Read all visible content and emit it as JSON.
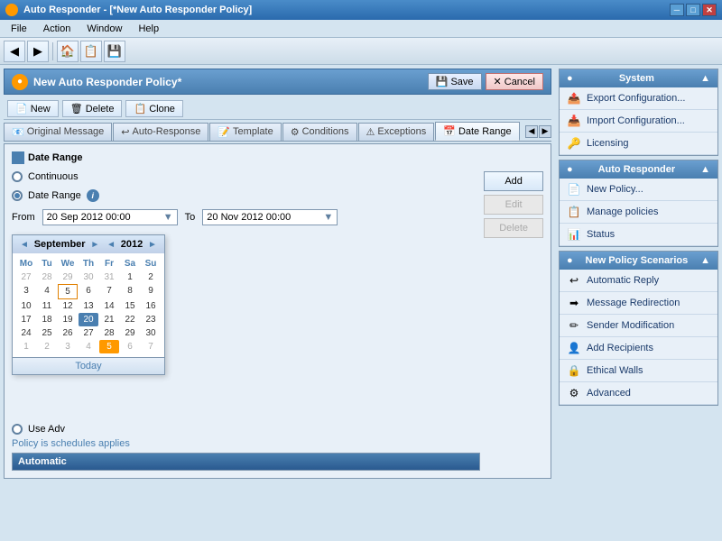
{
  "titlebar": {
    "title": "Auto Responder - [*New Auto Responder Policy]",
    "icon": "●",
    "controls": [
      "─",
      "□",
      "✕"
    ]
  },
  "menubar": {
    "items": [
      "File",
      "Action",
      "Window",
      "Help"
    ]
  },
  "toolbar": {
    "buttons": [
      "←",
      "→",
      "🏠",
      "⚙",
      "💾"
    ]
  },
  "policy": {
    "title": "New Auto Responder Policy*",
    "save_label": "Save",
    "cancel_label": "Cancel"
  },
  "actions": {
    "new_label": "New",
    "delete_label": "Delete",
    "clone_label": "Clone"
  },
  "tabs": [
    {
      "label": "Original Message",
      "active": false
    },
    {
      "label": "Auto-Response",
      "active": false
    },
    {
      "label": "Template",
      "active": false
    },
    {
      "label": "Conditions",
      "active": false
    },
    {
      "label": "Exceptions",
      "active": false
    },
    {
      "label": "Date Range",
      "active": true
    }
  ],
  "daterange": {
    "section_title": "Date Range",
    "continuous_label": "Continuous",
    "daterange_label": "Date Range",
    "from_label": "From",
    "from_value": "20 Sep 2012 00:00",
    "to_label": "To",
    "to_value": "20 Nov 2012 00:00",
    "use_adv_label": "Use Adv",
    "policy_applies": "schedules applies",
    "schedule_header": "Automatic",
    "add_btn": "Add",
    "edit_btn": "Edit",
    "delete_btn": "Delete"
  },
  "calendar": {
    "month": "September",
    "year": "2012",
    "prev_month": "◄",
    "next_month": "►",
    "prev_year": "◄",
    "next_year": "►",
    "day_headers": [
      "Mo",
      "Tu",
      "We",
      "Th",
      "Fr",
      "Sa",
      "Su"
    ],
    "weeks": [
      [
        "27",
        "28",
        "29",
        "30",
        "31",
        "1",
        "2"
      ],
      [
        "3",
        "4",
        "5",
        "6",
        "7",
        "8",
        "9"
      ],
      [
        "10",
        "11",
        "12",
        "13",
        "14",
        "15",
        "16"
      ],
      [
        "17",
        "18",
        "19",
        "20",
        "21",
        "22",
        "23"
      ],
      [
        "24",
        "25",
        "26",
        "27",
        "28",
        "29",
        "30"
      ],
      [
        "1",
        "2",
        "3",
        "4",
        "5",
        "6",
        "7"
      ]
    ],
    "today_label": "Today",
    "selected_day": "20",
    "today_day": "5",
    "other_month_first_row": [
      true,
      true,
      true,
      true,
      true,
      false,
      false
    ],
    "other_month_last_row": [
      true,
      true,
      true,
      true,
      true,
      true,
      true
    ]
  },
  "sidebar": {
    "system": {
      "title": "System",
      "items": [
        {
          "label": "Export Configuration...",
          "icon": "📤"
        },
        {
          "label": "Import Configuration...",
          "icon": "📥"
        },
        {
          "label": "Licensing",
          "icon": "🔑"
        }
      ]
    },
    "autoresponder": {
      "title": "Auto Responder",
      "items": [
        {
          "label": "New Policy...",
          "icon": "📄"
        },
        {
          "label": "Manage policies",
          "icon": "📋"
        },
        {
          "label": "Status",
          "icon": "📊"
        }
      ]
    },
    "newpolicyscenarios": {
      "title": "New Policy Scenarios",
      "items": [
        {
          "label": "Automatic Reply",
          "icon": "↩"
        },
        {
          "label": "Message Redirection",
          "icon": "➡"
        },
        {
          "label": "Sender Modification",
          "icon": "✏"
        },
        {
          "label": "Add Recipients",
          "icon": "👤"
        },
        {
          "label": "Ethical Walls",
          "icon": "🔒"
        },
        {
          "label": "Advanced",
          "icon": "⚙"
        }
      ]
    }
  }
}
